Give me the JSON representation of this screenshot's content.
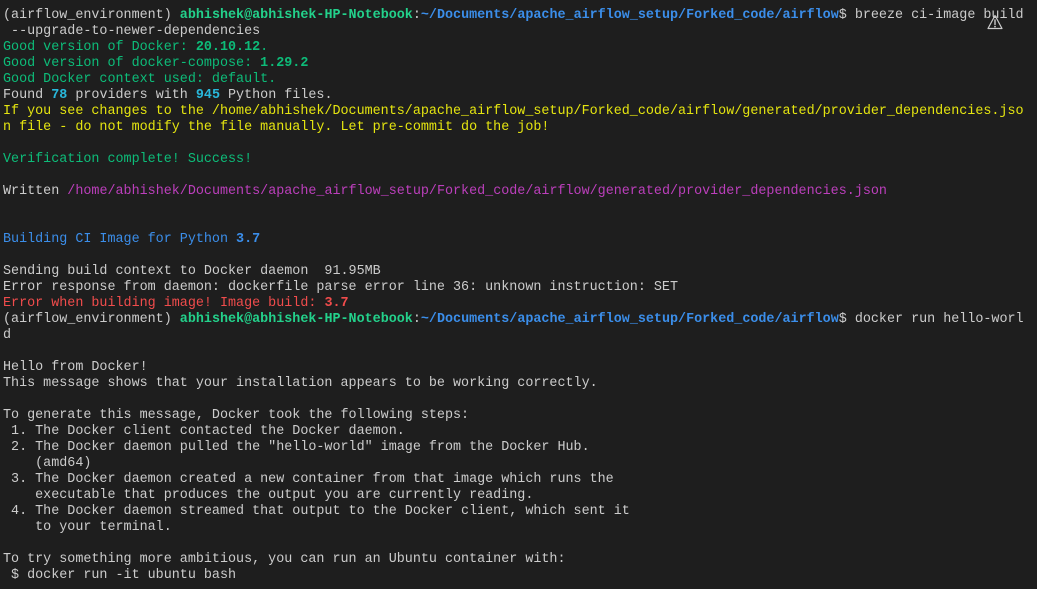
{
  "colors": {
    "background": "#1e1e1e",
    "default": "#cccccc",
    "user_host": "#23d18b",
    "path": "#3b8eea",
    "success": "#0dbc79",
    "info_number": "#29b8db",
    "warning": "#e5e510",
    "written_path": "#bc3fbc",
    "error": "#f14c4c"
  },
  "icons": {
    "warning": "warning-icon"
  },
  "terminal": {
    "lines": [
      [
        {
          "t": "(airflow_environment) ",
          "c": "default"
        },
        {
          "t": "abhishek@abhishek-HP-Notebook",
          "c": "user_host",
          "b": true
        },
        {
          "t": ":",
          "c": "default"
        },
        {
          "t": "~/Documents/apache_airflow_setup/Forked_code/airflow",
          "c": "path",
          "b": true
        },
        {
          "t": "$ breeze ci-image build",
          "c": "default"
        }
      ],
      [
        {
          "t": " --upgrade-to-newer-dependencies",
          "c": "default"
        }
      ],
      [
        {
          "t": "Good version of Docker: ",
          "c": "success"
        },
        {
          "t": "20.10.12",
          "c": "success",
          "b": true
        },
        {
          "t": ".",
          "c": "success"
        }
      ],
      [
        {
          "t": "Good version of docker-compose: ",
          "c": "success"
        },
        {
          "t": "1.29.2",
          "c": "success",
          "b": true
        }
      ],
      [
        {
          "t": "Good Docker context used: default.",
          "c": "success"
        }
      ],
      [
        {
          "t": "Found ",
          "c": "default"
        },
        {
          "t": "78",
          "c": "info_number",
          "b": true
        },
        {
          "t": " providers with ",
          "c": "default"
        },
        {
          "t": "945",
          "c": "info_number",
          "b": true
        },
        {
          "t": " Python files.",
          "c": "default"
        }
      ],
      [
        {
          "t": "If you see changes to the /home/abhishek/Documents/apache_airflow_setup/Forked_code/airflow/generated/provider_dependencies.jso",
          "c": "warning"
        }
      ],
      [
        {
          "t": "n file - do not modify the file manually. Let pre-commit do the job!",
          "c": "warning"
        }
      ],
      [],
      [
        {
          "t": "Verification complete! Success!",
          "c": "success"
        }
      ],
      [],
      [
        {
          "t": "Written ",
          "c": "default"
        },
        {
          "t": "/home/abhishek/Documents/apache_airflow_setup/Forked_code/airflow/generated/provider_dependencies.json",
          "c": "written_path"
        }
      ],
      [],
      [],
      [
        {
          "t": "Building CI Image for Python ",
          "c": "path"
        },
        {
          "t": "3.7",
          "c": "path",
          "b": true
        }
      ],
      [],
      [
        {
          "t": "Sending build context to Docker daemon  91.95MB",
          "c": "default"
        }
      ],
      [
        {
          "t": "Error response from daemon: dockerfile parse error line 36: unknown instruction: SET",
          "c": "default"
        }
      ],
      [
        {
          "t": "Error when building image! Image build: ",
          "c": "error"
        },
        {
          "t": "3.7",
          "c": "error",
          "b": true
        }
      ],
      [
        {
          "t": "(airflow_environment) ",
          "c": "default"
        },
        {
          "t": "abhishek@abhishek-HP-Notebook",
          "c": "user_host",
          "b": true
        },
        {
          "t": ":",
          "c": "default"
        },
        {
          "t": "~/Documents/apache_airflow_setup/Forked_code/airflow",
          "c": "path",
          "b": true
        },
        {
          "t": "$ docker run hello-worl",
          "c": "default"
        }
      ],
      [
        {
          "t": "d",
          "c": "default"
        }
      ],
      [],
      [
        {
          "t": "Hello from Docker!",
          "c": "default"
        }
      ],
      [
        {
          "t": "This message shows that your installation appears to be working correctly.",
          "c": "default"
        }
      ],
      [],
      [
        {
          "t": "To generate this message, Docker took the following steps:",
          "c": "default"
        }
      ],
      [
        {
          "t": " 1. The Docker client contacted the Docker daemon.",
          "c": "default"
        }
      ],
      [
        {
          "t": " 2. The Docker daemon pulled the \"hello-world\" image from the Docker Hub.",
          "c": "default"
        }
      ],
      [
        {
          "t": "    (amd64)",
          "c": "default"
        }
      ],
      [
        {
          "t": " 3. The Docker daemon created a new container from that image which runs the",
          "c": "default"
        }
      ],
      [
        {
          "t": "    executable that produces the output you are currently reading.",
          "c": "default"
        }
      ],
      [
        {
          "t": " 4. The Docker daemon streamed that output to the Docker client, which sent it",
          "c": "default"
        }
      ],
      [
        {
          "t": "    to your terminal.",
          "c": "default"
        }
      ],
      [],
      [
        {
          "t": "To try something more ambitious, you can run an Ubuntu container with:",
          "c": "default"
        }
      ],
      [
        {
          "t": " $ docker run -it ubuntu bash",
          "c": "default"
        }
      ]
    ]
  }
}
